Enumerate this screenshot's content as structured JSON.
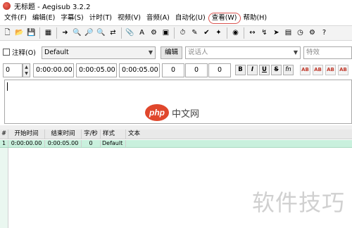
{
  "window": {
    "title": "无标题 - Aegisub 3.2.2",
    "icon": "aegisub-logo-icon"
  },
  "menu": [
    {
      "label": "文件(F)"
    },
    {
      "label": "编辑(E)"
    },
    {
      "label": "字幕(S)"
    },
    {
      "label": "计时(T)"
    },
    {
      "label": "视频(V)"
    },
    {
      "label": "音频(A)"
    },
    {
      "label": "自动化(U)"
    },
    {
      "label": "查看(W)",
      "highlighted": true
    },
    {
      "label": "帮助(H)"
    }
  ],
  "toolbar": [
    {
      "icon": "new-file-icon",
      "glyph": "🗋"
    },
    {
      "icon": "open-file-icon",
      "glyph": "📂"
    },
    {
      "icon": "save-icon",
      "glyph": "💾"
    },
    {
      "icon": "properties-icon",
      "glyph": "▦"
    },
    {
      "icon": "jump-to-icon",
      "glyph": "➜"
    },
    {
      "icon": "zoom-in-icon",
      "glyph": "🔍"
    },
    {
      "icon": "zoom-out-icon",
      "glyph": "🔎"
    },
    {
      "icon": "find-icon",
      "glyph": "🔍"
    },
    {
      "icon": "replace-icon",
      "glyph": "⇄"
    },
    {
      "icon": "attachments-icon",
      "glyph": "📎"
    },
    {
      "icon": "fonts-collector-icon",
      "glyph": "A"
    },
    {
      "icon": "automation-icon",
      "glyph": "⚙"
    },
    {
      "icon": "resample-icon",
      "glyph": "▣"
    },
    {
      "icon": "shift-times-icon",
      "glyph": "⏱"
    },
    {
      "icon": "translation-icon",
      "glyph": "✎"
    },
    {
      "icon": "spell-check-icon",
      "glyph": "✔"
    },
    {
      "icon": "assistant-icon",
      "glyph": "✦"
    },
    {
      "icon": "styles-manager-icon",
      "glyph": "◉"
    },
    {
      "icon": "timing-icon",
      "glyph": "↔"
    },
    {
      "icon": "snap-icon",
      "glyph": "↯"
    },
    {
      "icon": "kanji-timer-icon",
      "glyph": "➤"
    },
    {
      "icon": "video-details-icon",
      "glyph": "▤"
    },
    {
      "icon": "clock-icon",
      "glyph": "◷"
    },
    {
      "icon": "settings-icon",
      "glyph": "⚙"
    },
    {
      "icon": "help-icon",
      "glyph": "?"
    }
  ],
  "edit_box": {
    "comment_label": "注释(O)",
    "style_value": "Default",
    "edit_button": "编辑",
    "actor_placeholder": "说话人",
    "effect_placeholder": "特效",
    "layer": "0",
    "start_time": "0:00:00.00",
    "end_time": "0:00:05.00",
    "duration": "0:00:05.00",
    "margin_left": "0",
    "margin_right": "0",
    "margin_vertical": "0",
    "format_buttons": [
      "B",
      "I",
      "U",
      "S",
      "fn"
    ],
    "color_buttons": [
      "AB",
      "AB",
      "AB",
      "AB"
    ]
  },
  "grid": {
    "headers": [
      "#",
      "开始时间",
      "结束时间",
      "字/秒",
      "样式",
      "文本"
    ],
    "rows": [
      {
        "num": "1",
        "start": "0:00:00.00",
        "end": "0:00:05.00",
        "cps": "0",
        "style": "Default",
        "text": ""
      }
    ]
  },
  "watermarks": {
    "badge": "php",
    "text": "中文网",
    "corner": "软件技巧"
  },
  "colors": {
    "menu_highlight": "#d9534f",
    "selected_row": "#c9f0dd"
  }
}
